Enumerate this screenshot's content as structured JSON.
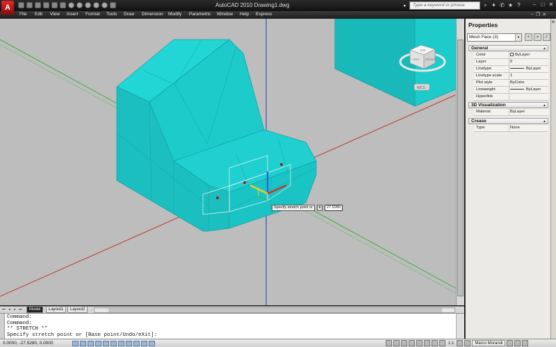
{
  "app": {
    "window_title": "AutoCAD 2010    Drawing1.dwg",
    "search_placeholder": "Type a keyword or phrase",
    "logo_letter": "A"
  },
  "menu": [
    "File",
    "Edit",
    "View",
    "Insert",
    "Format",
    "Tools",
    "Draw",
    "Dimension",
    "Modify",
    "Parametric",
    "Window",
    "Help",
    "Express"
  ],
  "viewcube": {
    "faces": {
      "top": "TOP",
      "left": "LEFT",
      "front": "FRONT"
    },
    "ucs_label": "WCS"
  },
  "dynamic_input": {
    "prompt": "Specify stretch point or",
    "value": "27.5280"
  },
  "layout_tabs": [
    "Model",
    "Layout1",
    "Layout2"
  ],
  "command_line": {
    "lines": [
      "Command:",
      "Command:",
      "** STRETCH **",
      "Specify stretch point or [Base point/Undo/eXit]:"
    ]
  },
  "status_bar": {
    "coordinates": "0.0000, -27.5280, 0.0000",
    "annotation_scale": "1:1",
    "workspace": "Marco Morandi"
  },
  "properties": {
    "title": "Properties",
    "selection": "Mesh Face (3)",
    "groups": [
      {
        "name": "General",
        "rows": [
          {
            "key": "Color",
            "value": "ByLayer"
          },
          {
            "key": "Layer",
            "value": "0"
          },
          {
            "key": "Linetype",
            "value": "ByLayer"
          },
          {
            "key": "Linetype scale",
            "value": "1"
          },
          {
            "key": "Plot style",
            "value": "ByColor"
          },
          {
            "key": "Lineweight",
            "value": "ByLayer"
          },
          {
            "key": "Hyperlink",
            "value": ""
          }
        ]
      },
      {
        "name": "3D Visualization",
        "rows": [
          {
            "key": "Material",
            "value": "ByLayer"
          }
        ]
      },
      {
        "name": "Crease",
        "rows": [
          {
            "key": "Type",
            "value": "None"
          }
        ]
      }
    ]
  },
  "colors": {
    "mesh": "#1ecbcb",
    "viewport_bg": "#bdbdbd",
    "axis_x": "#c0392b",
    "axis_y": "#3cb043",
    "axis_z": "#1f3cbf"
  }
}
